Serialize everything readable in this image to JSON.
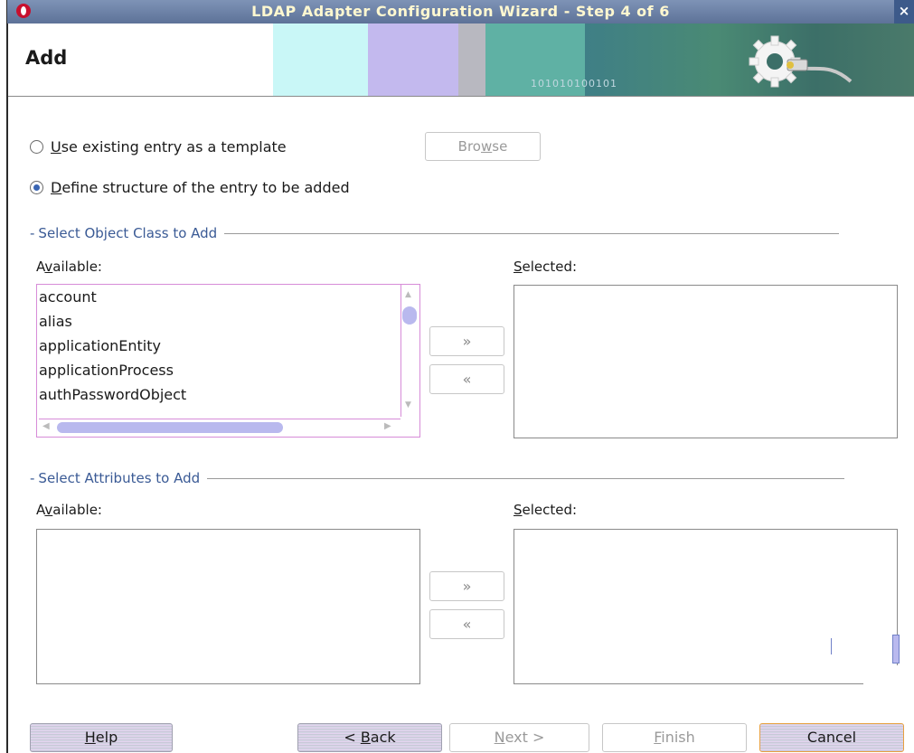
{
  "window": {
    "title": "LDAP Adapter Configuration Wizard - Step 4 of 6",
    "close_label": "×"
  },
  "header": {
    "title": "Add",
    "banner_binary": "101010100101"
  },
  "options": {
    "use_existing": {
      "label_underline": "U",
      "label_rest": "se existing entry as a template",
      "selected": false
    },
    "browse_label_pre": "Bro",
    "browse_label_ul": "w",
    "browse_label_post": "se",
    "define_structure": {
      "label_underline": "D",
      "label_rest": "efine structure of the entry to be added",
      "selected": true
    }
  },
  "object_class_section": {
    "title": "Select Object Class to Add",
    "available_label_pre": "A",
    "available_label_ul": "v",
    "available_label_post": "ailable:",
    "selected_label_ul": "S",
    "selected_label_post": "elected:",
    "available_items": [
      "account",
      "alias",
      "applicationEntity",
      "applicationProcess",
      "authPasswordObject"
    ],
    "move_right": "»",
    "move_left": "«"
  },
  "attributes_section": {
    "title": "Select Attributes to Add",
    "available_label_pre": "A",
    "available_label_ul": "v",
    "available_label_post": "ailable:",
    "selected_label_ul": "S",
    "selected_label_post": "elected:",
    "move_right": "»",
    "move_left": "«"
  },
  "footer": {
    "help_ul": "H",
    "help_post": "elp",
    "back_pre": "< ",
    "back_ul": "B",
    "back_post": "ack",
    "next_ul": "N",
    "next_post": "ext >",
    "finish_ul": "F",
    "finish_post": "inish",
    "cancel": "Cancel"
  }
}
